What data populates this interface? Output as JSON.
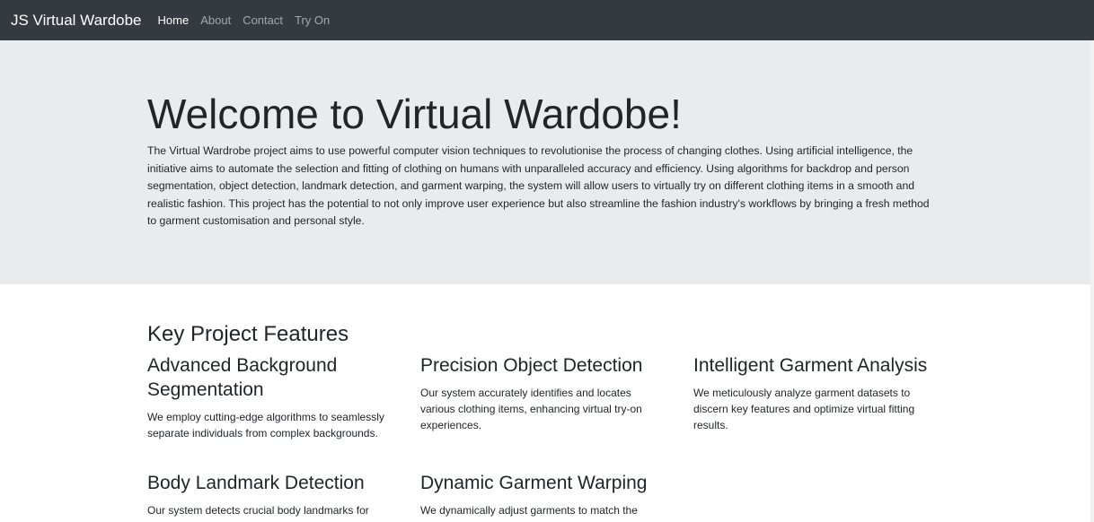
{
  "navbar": {
    "brand": "JS Virtual Wardobe",
    "links": [
      {
        "label": "Home",
        "active": true
      },
      {
        "label": "About",
        "active": false
      },
      {
        "label": "Contact",
        "active": false
      },
      {
        "label": "Try On",
        "active": false
      }
    ]
  },
  "hero": {
    "title": "Welcome to Virtual Wardobe!",
    "description": "The Virtual Wardrobe project aims to use powerful computer vision techniques to revolutionise the process of changing clothes. Using artificial intelligence, the initiative aims to automate the selection and fitting of clothing on humans with unparalleled accuracy and efficiency. Using algorithms for backdrop and person segmentation, object detection, landmark detection, and garment warping, the system will allow users to virtually try on different clothing items in a smooth and realistic fashion. This project has the potential to not only improve user experience but also streamline the fashion industry's workflows by bringing a fresh method to garment customisation and personal style."
  },
  "features": {
    "title": "Key Project Features",
    "items": [
      {
        "title": "Advanced Background Segmentation",
        "text": "We employ cutting-edge algorithms to seamlessly separate individuals from complex backgrounds."
      },
      {
        "title": "Precision Object Detection",
        "text": "Our system accurately identifies and locates various clothing items, enhancing virtual try-on experiences."
      },
      {
        "title": "Intelligent Garment Analysis",
        "text": "We meticulously analyze garment datasets to discern key features and optimize virtual fitting results."
      },
      {
        "title": "Body Landmark Detection",
        "text": "Our system detects crucial body landmarks for"
      },
      {
        "title": "Dynamic Garment Warping",
        "text": "We dynamically adjust garments to match the"
      }
    ]
  },
  "colors": {
    "navbar": "#343a40",
    "jumbotron": "#e9ecef",
    "text": "#212529"
  }
}
